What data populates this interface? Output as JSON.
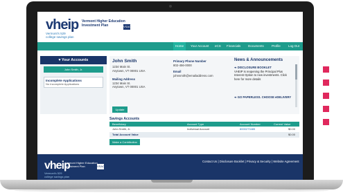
{
  "brand": {
    "logo": "vheip",
    "name_line1": "Vermont Higher Education",
    "name_line2": "Investment Plan",
    "tagline1": "Vermont's 529",
    "tagline2": "college savings plan",
    "badge": "VSAC"
  },
  "nav": {
    "tabs": [
      {
        "label": "Home"
      },
      {
        "label": "Your Account"
      },
      {
        "label": "eCS"
      },
      {
        "label": "Financials"
      },
      {
        "label": "Documents"
      },
      {
        "label": "Profile"
      },
      {
        "label": "Log Out"
      }
    ]
  },
  "accounts": {
    "title": "Your Accounts",
    "items": [
      {
        "label": "John Smith, Jr."
      }
    ],
    "incomplete_title": "Incomplete Applications",
    "incomplete_text": "No Incomplete Applications"
  },
  "profile": {
    "name": "John Smith",
    "addr1": "1234 Main St.",
    "addr2": "Anytown, VT 00001 USA",
    "mailing_label": "Mailing Address",
    "mail1": "1234 Main St.",
    "mail2": "Anytown, VT 00001 USA",
    "phone_label": "Primary Phone Number",
    "phone": "802-456-0000",
    "email_label": "Email",
    "email": "johnsmith@emailaddress.com",
    "update_label": "Update"
  },
  "news": {
    "title": "News & Announcements",
    "item1_head": "DISCLOSURE BOOKLET",
    "item1_body": "VHEIP is reopening the Principal Plus Interest Option to new investments. Click here for more details",
    "item2_head": "GO PAPERLESS. CHOOSE eDELIVERY"
  },
  "savings": {
    "title": "Savings Accounts",
    "headers": [
      "Beneficiary",
      "Account Type",
      "Account Number",
      "Current Value"
    ],
    "rows": [
      {
        "beneficiary": "John Smith, Jr.",
        "type": "Individual Account",
        "number": "8000273485",
        "value": "$0.00"
      }
    ],
    "total_label": "Total Account Value",
    "total_value": "$0.00",
    "contrib_label": "Make a Contribution"
  },
  "footer": {
    "logo": "vheip",
    "sub1": "Vermont Higher Education",
    "sub2": "Investment Plan",
    "tag1": "Vermont's 529",
    "tag2": "college savings plan",
    "badge": "VSAC",
    "links": "Contact Us | Disclosure Booklet | Privacy & Security | Website Agreement"
  },
  "colors": {
    "primary": "#1a3568",
    "teal": "#1e9c8c",
    "accent_squares": "#e0285d"
  }
}
